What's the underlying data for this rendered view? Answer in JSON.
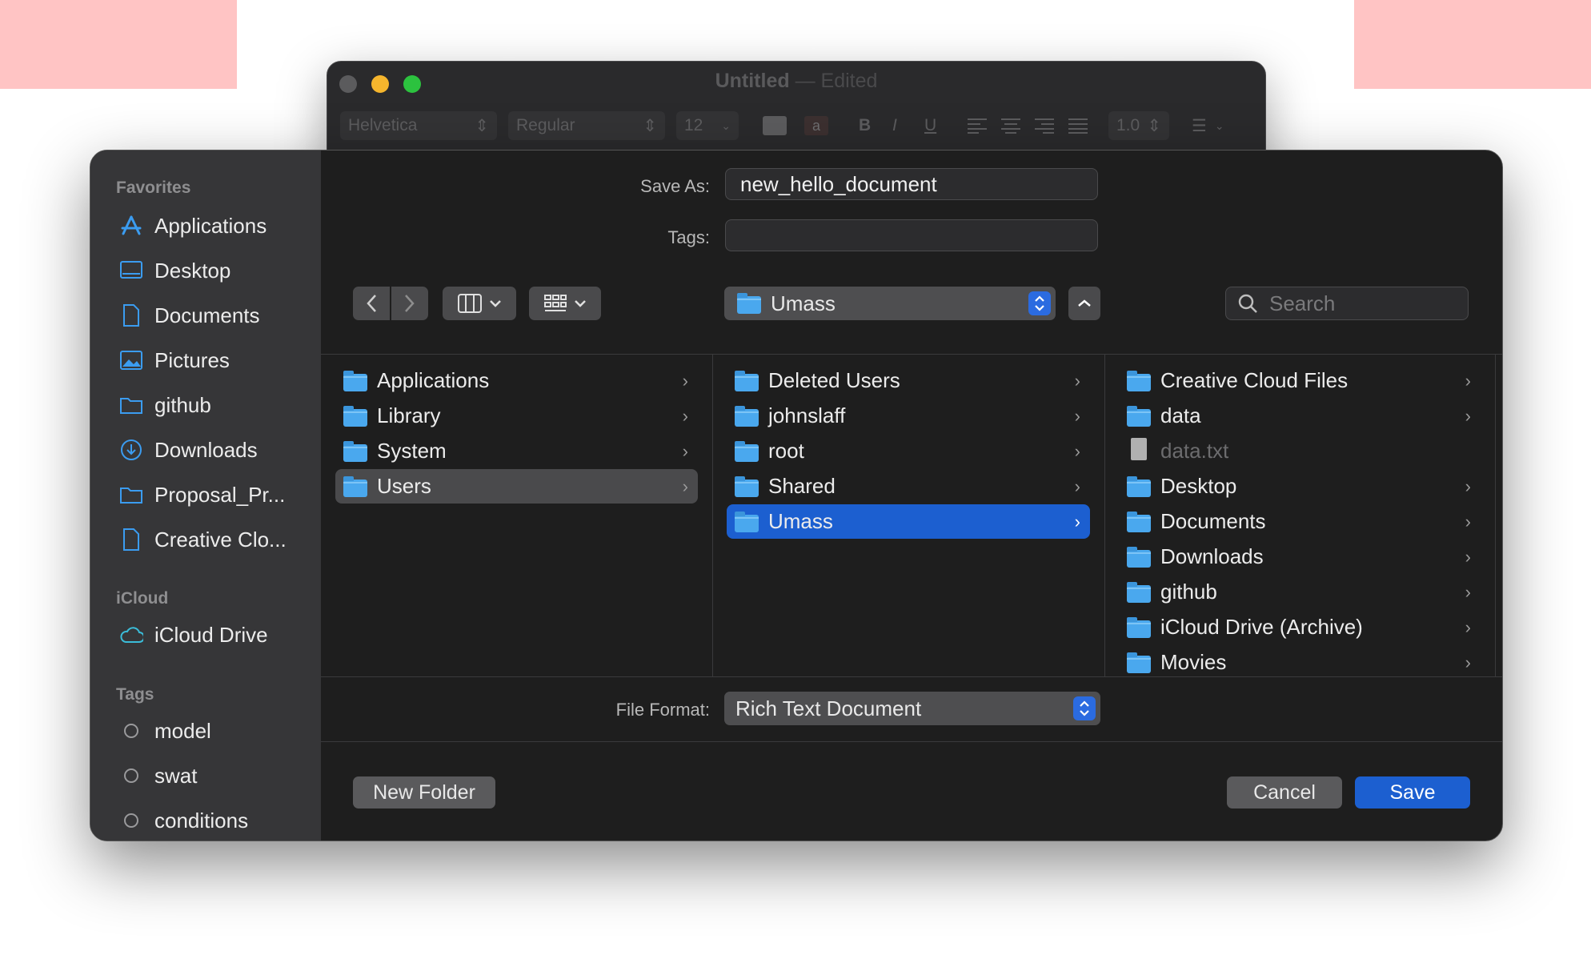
{
  "background_window": {
    "title": "Untitled",
    "separator": "—",
    "status": "Edited",
    "toolbar": {
      "font": "Helvetica",
      "style": "Regular",
      "size": "12",
      "bold": "B",
      "italic": "I",
      "underline": "U",
      "spacing": "1.0"
    }
  },
  "sidebar": {
    "favorites_header": "Favorites",
    "favorites": [
      {
        "label": "Applications",
        "icon": "app-store-icon"
      },
      {
        "label": "Desktop",
        "icon": "desktop-icon"
      },
      {
        "label": "Documents",
        "icon": "document-icon"
      },
      {
        "label": "Pictures",
        "icon": "photo-icon"
      },
      {
        "label": "github",
        "icon": "folder-icon"
      },
      {
        "label": "Downloads",
        "icon": "download-icon"
      },
      {
        "label": "Proposal_Pr...",
        "icon": "folder-icon"
      },
      {
        "label": "Creative Clo...",
        "icon": "document-icon"
      }
    ],
    "icloud_header": "iCloud",
    "icloud": [
      {
        "label": "iCloud Drive",
        "icon": "cloud-icon"
      }
    ],
    "tags_header": "Tags",
    "tags": [
      {
        "label": "model"
      },
      {
        "label": "swat"
      },
      {
        "label": "conditions"
      }
    ]
  },
  "save": {
    "save_as_label": "Save As:",
    "save_as_value": "new_hello_document",
    "tags_label": "Tags:",
    "tags_value": ""
  },
  "nav": {
    "location": "Umass",
    "search_placeholder": "Search"
  },
  "columns": [
    {
      "items": [
        {
          "label": "Applications",
          "kind": "folder",
          "chevron": true
        },
        {
          "label": "Library",
          "kind": "folder",
          "chevron": true
        },
        {
          "label": "System",
          "kind": "folder",
          "chevron": true
        },
        {
          "label": "Users",
          "kind": "folder",
          "chevron": true,
          "selected": "grey"
        }
      ]
    },
    {
      "items": [
        {
          "label": "Deleted Users",
          "kind": "folder",
          "chevron": true
        },
        {
          "label": "johnslaff",
          "kind": "folder",
          "chevron": true
        },
        {
          "label": "root",
          "kind": "folder",
          "chevron": true
        },
        {
          "label": "Shared",
          "kind": "folder",
          "chevron": true
        },
        {
          "label": "Umass",
          "kind": "folder",
          "chevron": true,
          "selected": "blue"
        }
      ]
    },
    {
      "items": [
        {
          "label": "Creative Cloud Files",
          "kind": "folder",
          "chevron": true
        },
        {
          "label": "data",
          "kind": "folder",
          "chevron": true
        },
        {
          "label": "data.txt",
          "kind": "file",
          "chevron": false,
          "dimmed": true
        },
        {
          "label": "Desktop",
          "kind": "folder",
          "chevron": true
        },
        {
          "label": "Documents",
          "kind": "folder",
          "chevron": true
        },
        {
          "label": "Downloads",
          "kind": "folder",
          "chevron": true
        },
        {
          "label": "github",
          "kind": "folder",
          "chevron": true
        },
        {
          "label": "iCloud Drive (Archive)",
          "kind": "folder",
          "chevron": true
        },
        {
          "label": "Movies",
          "kind": "folder",
          "chevron": true
        }
      ]
    }
  ],
  "format": {
    "label": "File Format:",
    "value": "Rich Text Document"
  },
  "buttons": {
    "new_folder": "New Folder",
    "cancel": "Cancel",
    "save": "Save"
  },
  "colors": {
    "accent": "#1c5fd0",
    "folder": "#4aa8ee",
    "sidebar_icon": "#3b9cf0"
  }
}
